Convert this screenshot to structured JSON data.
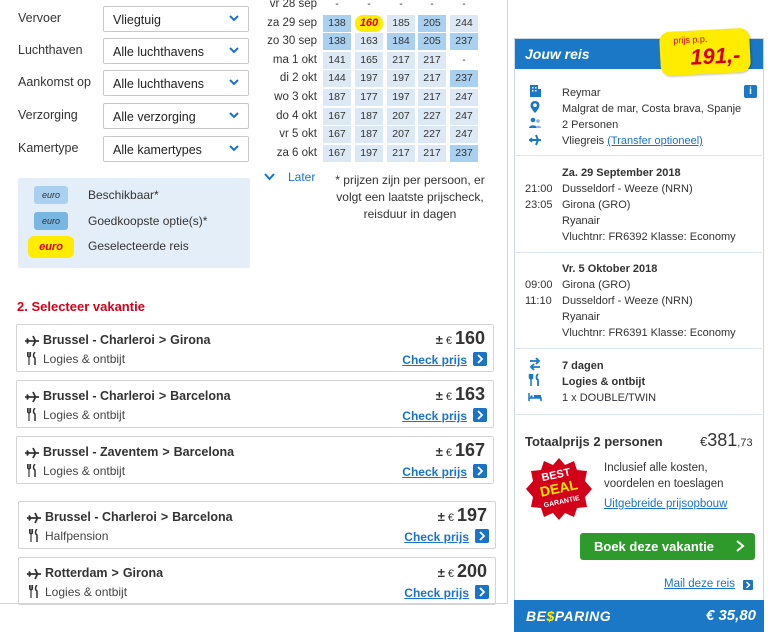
{
  "filters": [
    {
      "label": "Vervoer",
      "value": "Vliegtuig"
    },
    {
      "label": "Luchthaven",
      "value": "Alle luchthavens"
    },
    {
      "label": "Aankomst op",
      "value": "Alle luchthavens"
    },
    {
      "label": "Verzorging",
      "value": "Alle verzorging"
    },
    {
      "label": "Kamertype",
      "value": "Alle kamertypes"
    }
  ],
  "legend": {
    "pill_text": "euro",
    "available": "Beschikbaar*",
    "cheapest": "Goedkoopste optie(s)*",
    "selected": "Geselecteerde reis"
  },
  "calendar": {
    "rows": [
      {
        "date": "vr 28 sep",
        "cells": [
          {
            "v": "-",
            "t": "dash"
          },
          {
            "v": "-",
            "t": "dash"
          },
          {
            "v": "-",
            "t": "dash"
          },
          {
            "v": "-",
            "t": "dash"
          },
          {
            "v": "-",
            "t": "dash"
          }
        ]
      },
      {
        "date": "za 29 sep",
        "cells": [
          {
            "v": "138",
            "t": "best"
          },
          {
            "v": "160",
            "t": "sel"
          },
          {
            "v": "185",
            "t": "n"
          },
          {
            "v": "205",
            "t": "best"
          },
          {
            "v": "244",
            "t": "n"
          }
        ]
      },
      {
        "date": "zo 30 sep",
        "cells": [
          {
            "v": "138",
            "t": "best"
          },
          {
            "v": "163",
            "t": "n"
          },
          {
            "v": "184",
            "t": "best"
          },
          {
            "v": "205",
            "t": "best"
          },
          {
            "v": "237",
            "t": "best"
          }
        ]
      },
      {
        "date": "ma 1 okt",
        "cells": [
          {
            "v": "141",
            "t": "n"
          },
          {
            "v": "165",
            "t": "n"
          },
          {
            "v": "217",
            "t": "n"
          },
          {
            "v": "217",
            "t": "n"
          },
          {
            "v": "-",
            "t": "dash"
          }
        ]
      },
      {
        "date": "di 2 okt",
        "cells": [
          {
            "v": "144",
            "t": "n"
          },
          {
            "v": "197",
            "t": "n"
          },
          {
            "v": "197",
            "t": "n"
          },
          {
            "v": "217",
            "t": "n"
          },
          {
            "v": "237",
            "t": "best"
          }
        ]
      },
      {
        "date": "wo 3 okt",
        "cells": [
          {
            "v": "187",
            "t": "n"
          },
          {
            "v": "177",
            "t": "n"
          },
          {
            "v": "197",
            "t": "n"
          },
          {
            "v": "217",
            "t": "n"
          },
          {
            "v": "247",
            "t": "n"
          }
        ]
      },
      {
        "date": "do 4 okt",
        "cells": [
          {
            "v": "167",
            "t": "n"
          },
          {
            "v": "187",
            "t": "n"
          },
          {
            "v": "207",
            "t": "n"
          },
          {
            "v": "227",
            "t": "n"
          },
          {
            "v": "247",
            "t": "n"
          }
        ]
      },
      {
        "date": "vr 5 okt",
        "cells": [
          {
            "v": "167",
            "t": "n"
          },
          {
            "v": "187",
            "t": "n"
          },
          {
            "v": "207",
            "t": "n"
          },
          {
            "v": "227",
            "t": "n"
          },
          {
            "v": "247",
            "t": "n"
          }
        ]
      },
      {
        "date": "za 6 okt",
        "cells": [
          {
            "v": "167",
            "t": "n"
          },
          {
            "v": "197",
            "t": "n"
          },
          {
            "v": "217",
            "t": "n"
          },
          {
            "v": "217",
            "t": "n"
          },
          {
            "v": "237",
            "t": "best"
          }
        ]
      }
    ],
    "later_label": "Later",
    "note": "* prijzen zijn per persoon, er volgt een laatste prijscheck, reisduur in dagen"
  },
  "section_title": "2. Selecteer vakantie",
  "price_prefix": "±",
  "currency": "€",
  "check_label": "Check prijs",
  "vacations": [
    {
      "from": "Brussel - Charleroi",
      "to": "Girona",
      "board": "Logies & ontbijt",
      "price": "160"
    },
    {
      "from": "Brussel - Charleroi",
      "to": "Barcelona",
      "board": "Logies & ontbijt",
      "price": "163"
    },
    {
      "from": "Brussel - Zaventem",
      "to": "Barcelona",
      "board": "Logies & ontbijt",
      "price": "167"
    },
    {
      "from": "Brussel - Charleroi",
      "to": "Barcelona",
      "board": "Halfpension",
      "price": "197"
    },
    {
      "from": "Rotterdam",
      "to": "Girona",
      "board": "Logies & ontbijt",
      "price": "200"
    }
  ],
  "trip": {
    "title": "Jouw reis",
    "sticker_label": "prijs p.p.",
    "sticker_price": "191,-",
    "hotel": "Reymar",
    "location": "Malgrat de mar, Costa brava, Spanje",
    "persons": "2 Personen",
    "transport_prefix": "Vliegreis",
    "transfer_link": "(Transfer optioneel)",
    "outbound": {
      "date": "Za. 29 September 2018",
      "dep_time": "21:00",
      "dep": "Dusseldorf - Weeze (NRN)",
      "arr_time": "23:05",
      "arr": "Girona (GRO)",
      "airline": "Ryanair",
      "flight": "Vluchtnr: FR6392 Klasse: Economy"
    },
    "return": {
      "date": "Vr. 5 Oktober 2018",
      "dep_time": "09:00",
      "dep": "Girona (GRO)",
      "arr_time": "11:10",
      "arr": "Dusseldorf - Weeze (NRN)",
      "airline": "Ryanair",
      "flight": "Vluchtnr: FR6391 Klasse: Economy"
    },
    "duration": "7 dagen",
    "board": "Logies & ontbijt",
    "room": "1 x DOUBLE/TWIN",
    "total_label": "Totaalprijs 2 personen",
    "total_main": "381",
    "total_cents": ",73",
    "badge_lines": [
      "BEST",
      "DEAL",
      "GARANTIE"
    ],
    "inclusive": "Inclusief alle kosten, voordelen en toeslagen",
    "breakdown_link": "Uitgebreide prijsopbouw",
    "book_label": "Boek deze vakantie",
    "mail_label": "Mail deze reis",
    "brand_pre": "BE",
    "brand_dollar": "$",
    "brand_post": "PARING",
    "saving": "€ 35,80"
  },
  "colors": {
    "accent_blue": "#1a78c6",
    "red": "#d3001a",
    "yellow": "#ffec00",
    "green": "#2f9a2c"
  }
}
